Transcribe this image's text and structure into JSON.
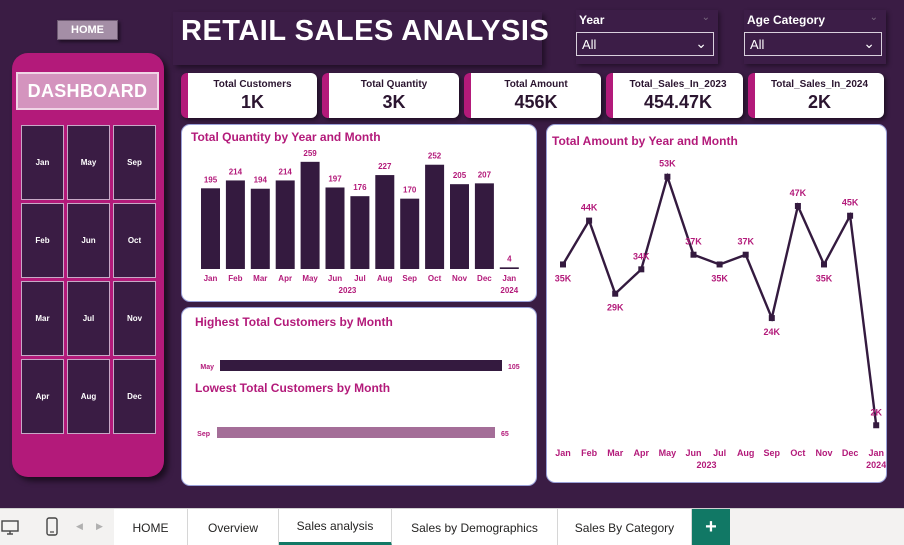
{
  "nav": {
    "home_label": "HOME",
    "dashboard_label": "DASHBOARD"
  },
  "month_slicer": [
    [
      "Jan",
      "May",
      "Sep"
    ],
    [
      "Feb",
      "Jun",
      "Oct"
    ],
    [
      "Mar",
      "Jul",
      "Nov"
    ],
    [
      "Apr",
      "Aug",
      "Dec"
    ]
  ],
  "header": {
    "title": "RETAIL SALES ANALYSIS"
  },
  "filters": {
    "year": {
      "label": "Year",
      "value": "All"
    },
    "age": {
      "label": "Age Category",
      "value": "All"
    }
  },
  "kpis": [
    {
      "title": "Total Customers",
      "value": "1K"
    },
    {
      "title": "Total Quantity",
      "value": "3K"
    },
    {
      "title": "Total Amount",
      "value": "456K"
    },
    {
      "title": "Total_Sales_In_2023",
      "value": "454.47K"
    },
    {
      "title": "Total_Sales_In_2024",
      "value": "2K"
    }
  ],
  "colors": {
    "brand": "#b31a7a",
    "dark": "#3a1c44",
    "bar": "#341a3f",
    "low_bar": "#a46e98",
    "tab_accent": "#117865"
  },
  "chart_data": [
    {
      "type": "bar",
      "title": "Total Quantity by Year and Month",
      "categories": [
        "Jan",
        "Feb",
        "Mar",
        "Apr",
        "May",
        "Jun",
        "Jul",
        "Aug",
        "Sep",
        "Oct",
        "Nov",
        "Dec",
        "Jan"
      ],
      "year_labels": [
        {
          "label": "2023",
          "center_index": 5.5
        },
        {
          "label": "2024",
          "center_index": 12
        }
      ],
      "values": [
        195,
        214,
        194,
        214,
        259,
        197,
        176,
        227,
        170,
        252,
        205,
        207,
        4
      ],
      "ylim": [
        0,
        290
      ]
    },
    {
      "type": "bar",
      "title": "Highest Total Customers by Month",
      "categories": [
        "May"
      ],
      "values": [
        105
      ],
      "xlim": [
        0,
        105
      ]
    },
    {
      "type": "bar",
      "title": "Lowest Total Customers by Month",
      "categories": [
        "Sep"
      ],
      "values": [
        65
      ],
      "xlim": [
        0,
        65
      ]
    },
    {
      "type": "line",
      "title": "Total Amount by Year and Month",
      "categories": [
        "Jan",
        "Feb",
        "Mar",
        "Apr",
        "May",
        "Jun",
        "Jul",
        "Aug",
        "Sep",
        "Oct",
        "Nov",
        "Dec",
        "Jan"
      ],
      "year_labels": [
        {
          "label": "2023",
          "center_index": 5.5
        },
        {
          "label": "2024",
          "center_index": 12
        }
      ],
      "values": [
        35,
        44,
        29,
        34,
        53,
        37,
        35,
        37,
        24,
        47,
        35,
        45,
        2
      ],
      "labels": [
        "35K",
        "44K",
        "29K",
        "34K",
        "53K",
        "37K",
        "35K",
        "37K",
        "24K",
        "47K",
        "35K",
        "45K",
        "2K"
      ],
      "ylim": [
        0,
        55
      ]
    }
  ],
  "tabs": {
    "items": [
      "HOME",
      "Overview",
      "Sales analysis",
      "Sales by Demographics",
      "Sales By Category"
    ],
    "active": "Sales analysis",
    "add_label": "+"
  }
}
